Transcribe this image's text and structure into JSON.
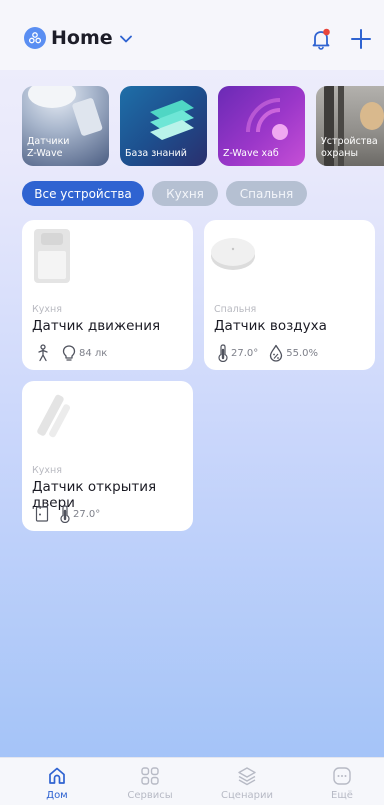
{
  "header": {
    "title": "Home"
  },
  "banners": [
    {
      "label": "Датчики\nZ-Wave"
    },
    {
      "label": "База знаний"
    },
    {
      "label": "Z-Wave хаб"
    },
    {
      "label": "Устройства\nохраны"
    }
  ],
  "filters": [
    {
      "label": "Все устройства",
      "active": true
    },
    {
      "label": "Кухня",
      "active": false
    },
    {
      "label": "Спальня",
      "active": false
    }
  ],
  "devices": [
    {
      "room": "Кухня",
      "name": "Датчик движения",
      "attrs": [
        {
          "icon": "motion-person-icon",
          "value": ""
        },
        {
          "icon": "light-bulb-icon",
          "value": "84 лк"
        }
      ]
    },
    {
      "room": "Спальня",
      "name": "Датчик воздуха",
      "attrs": [
        {
          "icon": "thermometer-icon",
          "value": "27.0°"
        },
        {
          "icon": "humidity-drop-icon",
          "value": "55.0%"
        }
      ]
    },
    {
      "room": "Кухня",
      "name": "Датчик открытия двери",
      "attrs": [
        {
          "icon": "door-icon",
          "value": ""
        },
        {
          "icon": "thermometer-icon",
          "value": "27.0°"
        }
      ]
    }
  ],
  "tabs": [
    {
      "label": "Дом",
      "icon": "home-icon",
      "active": true
    },
    {
      "label": "Сервисы",
      "icon": "grid-icon",
      "active": false
    },
    {
      "label": "Сценарии",
      "icon": "layers-icon",
      "active": false
    },
    {
      "label": "Ещё",
      "icon": "more-icon",
      "active": false
    }
  ],
  "colors": {
    "accent": "#2f63d1",
    "notification_dot": "#e8453c"
  }
}
